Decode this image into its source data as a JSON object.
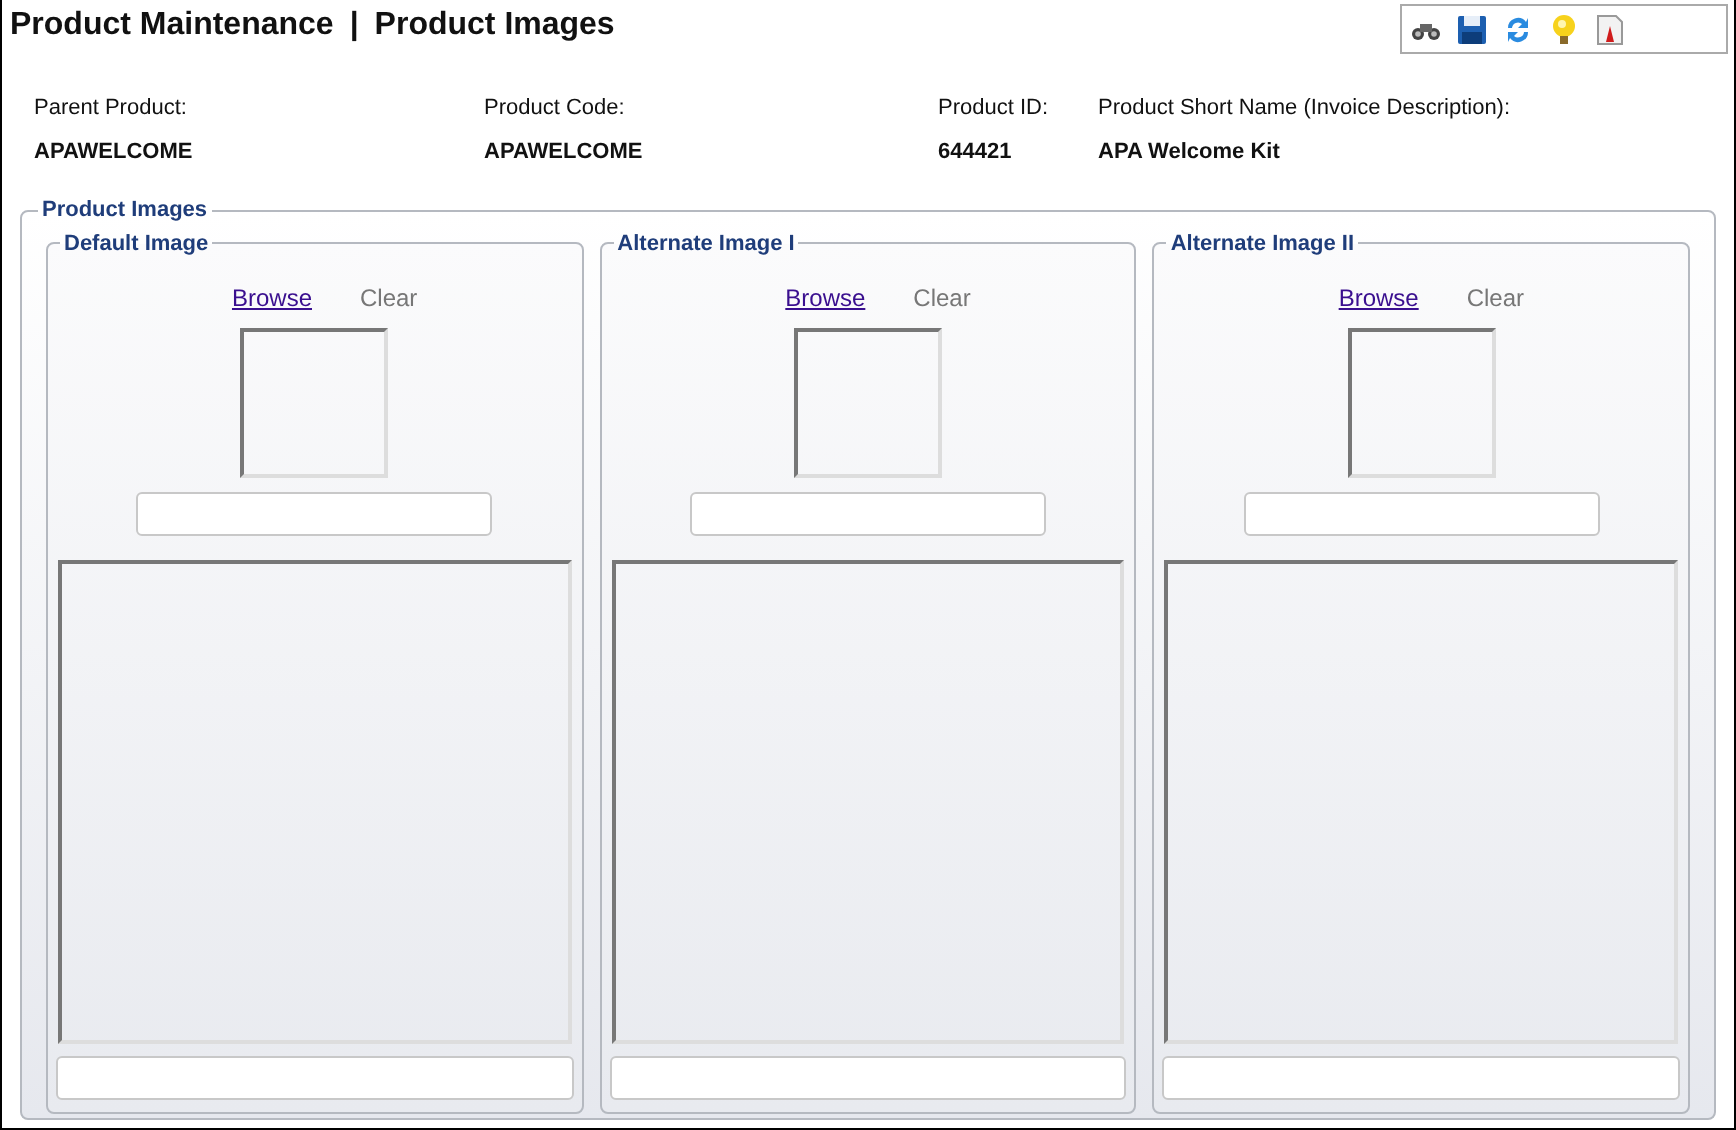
{
  "header": {
    "title": "Product Maintenance",
    "separator": "|",
    "subtitle": "Product Images"
  },
  "fields": [
    {
      "label": "Parent Product:",
      "value": "APAWELCOME"
    },
    {
      "label": "Product Code:",
      "value": "APAWELCOME"
    },
    {
      "label": "Product ID:",
      "value": "644421"
    },
    {
      "label": "Product Short Name (Invoice Description):",
      "value": "APA Welcome Kit"
    }
  ],
  "group": {
    "title": "Product Images",
    "panels": [
      {
        "title": "Default Image",
        "browse": {
          "label": "Browse",
          "disabled": false
        },
        "clear": {
          "label": "Clear",
          "disabled": true
        }
      },
      {
        "title": "Alternate Image I",
        "browse": {
          "label": "Browse",
          "disabled": false
        },
        "clear": {
          "label": "Clear",
          "disabled": true
        }
      },
      {
        "title": "Alternate Image II",
        "browse": {
          "label": "Browse",
          "disabled": false
        },
        "clear": {
          "label": "Clear",
          "disabled": true
        }
      }
    ]
  }
}
